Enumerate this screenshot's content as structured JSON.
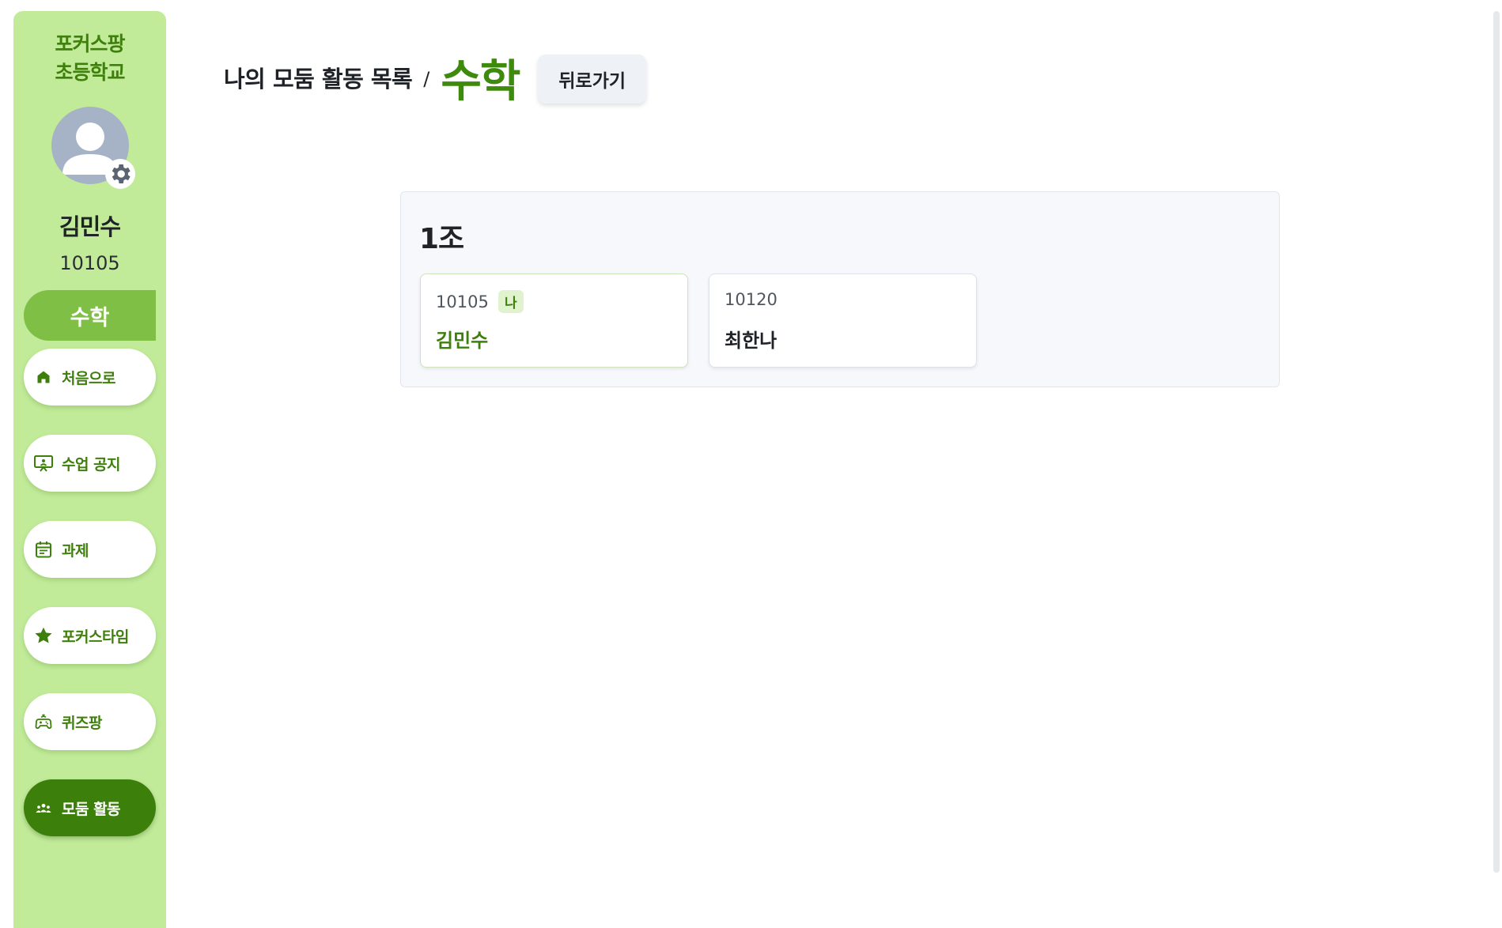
{
  "colors": {
    "sidebar_bg": "#c1eb99",
    "brand_green": "#3d7f0b",
    "subject_badge": "#7fbf45",
    "title_green": "#3d8a0c"
  },
  "sidebar": {
    "school_line1": "포커스팡",
    "school_line2": "초등학교",
    "avatar_icon": "user-avatar-icon",
    "settings_icon": "gear-icon",
    "student_name": "김민수",
    "student_id": "10105",
    "subject": "수학",
    "nav": [
      {
        "label": "처음으로",
        "icon": "home-icon"
      },
      {
        "label": "수업 공지",
        "icon": "presentation-icon"
      },
      {
        "label": "과제",
        "icon": "calendar-icon"
      },
      {
        "label": "포커스타임",
        "icon": "star-icon"
      },
      {
        "label": "퀴즈팡",
        "icon": "gamepad-icon"
      },
      {
        "label": "모둠 활동",
        "icon": "group-icon",
        "active": true
      }
    ]
  },
  "header": {
    "breadcrumb_parent": "나의 모둠 활동 목록",
    "separator": "/",
    "title": "수학",
    "back_label": "뒤로가기"
  },
  "group": {
    "name": "1조",
    "members": [
      {
        "id": "10105",
        "name": "김민수",
        "badge": "나"
      },
      {
        "id": "10120",
        "name": "최한나"
      }
    ]
  }
}
